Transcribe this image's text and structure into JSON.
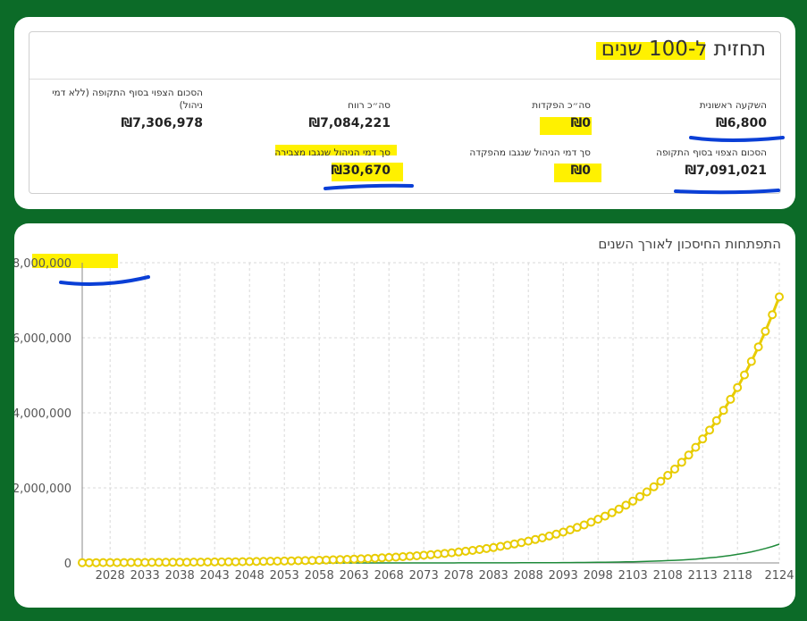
{
  "summary": {
    "title": "תחזית ל-100 שנים",
    "stats": [
      {
        "label": "השקעה ראשונית",
        "value": "₪6,800"
      },
      {
        "label": "סה״כ הפקדות",
        "value": "₪0"
      },
      {
        "label": "סה״כ רווח",
        "value": "₪7,084,221"
      },
      {
        "label": "הסכום הצפוי בסוף התקופה (ללא דמי ניהול)",
        "value": "₪7,306,978"
      },
      {
        "label": "הסכום הצפוי בסוף התקופה",
        "value": "₪7,091,021"
      },
      {
        "label": "סך דמי הניהול שנגבו מהפקדה",
        "value": "₪0"
      },
      {
        "label": "סך דמי הניהול שנגבו מצבירה",
        "value": "₪30,670"
      }
    ]
  },
  "chart": {
    "title": "התפתחות החיסכון לאורך השנים"
  },
  "colors": {
    "page_background": "#0c6b28",
    "highlight": "#fff100",
    "pen": "#0a3fd6",
    "savings_series": "#e8cc00",
    "deposits_series": "#1f8a3a"
  },
  "chart_data": {
    "type": "line",
    "x_start": 2024,
    "x_end": 2124,
    "x_tick_labels": [
      "2028",
      "2033",
      "2038",
      "2043",
      "2048",
      "2053",
      "2058",
      "2063",
      "2068",
      "2073",
      "2078",
      "2083",
      "2088",
      "2093",
      "2098",
      "2103",
      "2108",
      "2113",
      "2118",
      "2124"
    ],
    "ylim": [
      0,
      8000000
    ],
    "y_tick_labels": [
      "0",
      "2,000,000",
      "4,000,000",
      "6,000,000",
      "8,000,000"
    ],
    "y_ticks": [
      0,
      2000000,
      4000000,
      6000000,
      8000000
    ],
    "grid": true,
    "series": [
      {
        "start": 6800,
        "end": 7091021,
        "markers": true
      },
      {
        "start": 0,
        "end": 500000,
        "markers": false
      }
    ]
  }
}
